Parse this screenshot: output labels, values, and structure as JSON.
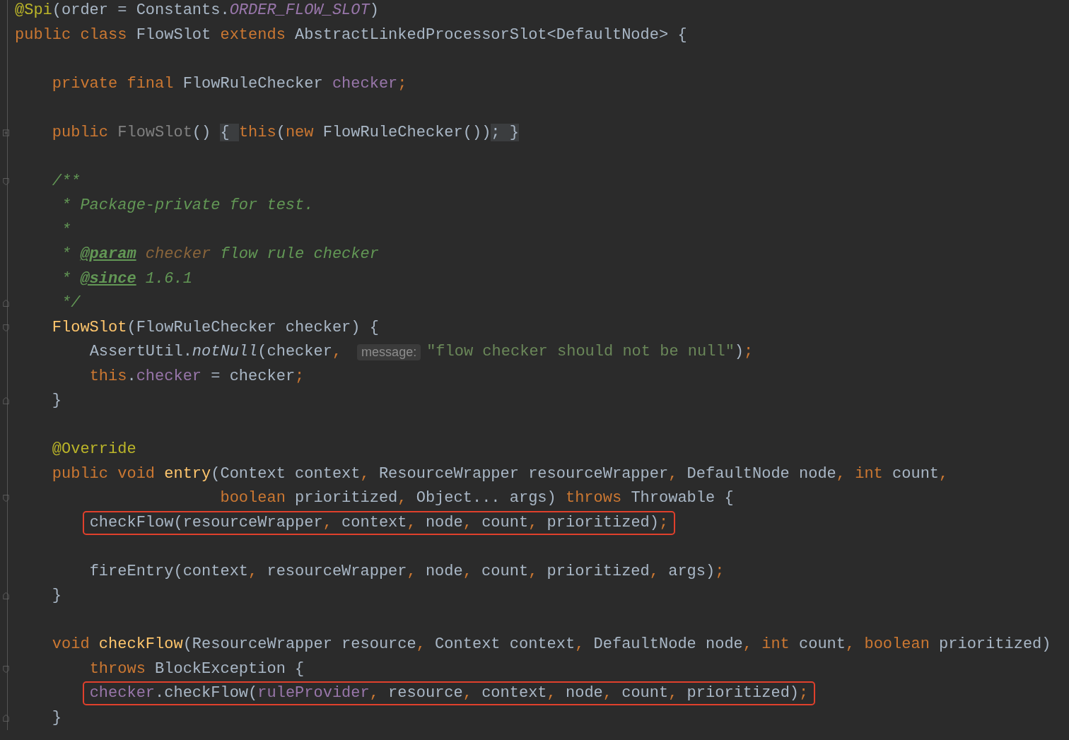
{
  "editor": {
    "lines": [
      {
        "kind": "code",
        "tokens": [
          {
            "kind": "ann",
            "text": "@Spi"
          },
          {
            "kind": "plain",
            "text": "(order = Constants."
          },
          {
            "kind": "const",
            "text": "ORDER_FLOW_SLOT"
          },
          {
            "kind": "plain",
            "text": ")"
          }
        ]
      },
      {
        "kind": "code",
        "tokens": [
          {
            "kind": "kw",
            "text": "public class "
          },
          {
            "kind": "plain",
            "text": "FlowSlot "
          },
          {
            "kind": "kw",
            "text": "extends "
          },
          {
            "kind": "plain",
            "text": "AbstractLinkedProcessorSlot<DefaultNode> {"
          }
        ]
      },
      {
        "kind": "blank"
      },
      {
        "kind": "code",
        "tokens": [
          {
            "kind": "kw",
            "text": "    private final "
          },
          {
            "kind": "plain",
            "text": "FlowRuleChecker "
          },
          {
            "kind": "field",
            "text": "checker"
          },
          {
            "kind": "kw",
            "text": ";"
          }
        ]
      },
      {
        "kind": "blank"
      },
      {
        "kind": "folded",
        "tokens": [
          {
            "kind": "kw",
            "text": "    public "
          },
          {
            "kind": "unused",
            "text": "FlowSlot"
          },
          {
            "kind": "plain",
            "text": "() "
          },
          {
            "kind": "folded",
            "text": "{ "
          },
          {
            "kind": "kw",
            "text": "this"
          },
          {
            "kind": "plain",
            "text": "("
          },
          {
            "kind": "kw",
            "text": "new "
          },
          {
            "kind": "plain",
            "text": "FlowRuleChecker())"
          },
          {
            "kind": "folded",
            "text": "; }"
          }
        ]
      },
      {
        "kind": "blank"
      },
      {
        "kind": "fold_start",
        "tokens": [
          {
            "kind": "doc",
            "text": "    /**"
          }
        ]
      },
      {
        "kind": "code",
        "tokens": [
          {
            "kind": "doc",
            "text": "     * Package-private for test."
          }
        ]
      },
      {
        "kind": "code",
        "tokens": [
          {
            "kind": "doc",
            "text": "     *"
          }
        ]
      },
      {
        "kind": "code",
        "tokens": [
          {
            "kind": "doc",
            "text": "     * "
          },
          {
            "kind": "doctag",
            "text": "@param"
          },
          {
            "kind": "docparam",
            "text": " checker"
          },
          {
            "kind": "doc",
            "text": " flow rule checker"
          }
        ]
      },
      {
        "kind": "code",
        "tokens": [
          {
            "kind": "doc",
            "text": "     * "
          },
          {
            "kind": "doctag",
            "text": "@since"
          },
          {
            "kind": "doc",
            "text": " 1.6.1"
          }
        ]
      },
      {
        "kind": "fold_end",
        "tokens": [
          {
            "kind": "doc",
            "text": "     */"
          }
        ]
      },
      {
        "kind": "fold_start",
        "tokens": [
          {
            "kind": "decl",
            "text": "    FlowSlot"
          },
          {
            "kind": "plain",
            "text": "(FlowRuleChecker checker) {"
          }
        ]
      },
      {
        "kind": "code",
        "tokens": [
          {
            "kind": "plain",
            "text": "        AssertUtil."
          },
          {
            "kind": "static",
            "text": "notNull"
          },
          {
            "kind": "plain",
            "text": "(checker"
          },
          {
            "kind": "kw",
            "text": ","
          },
          {
            "kind": "hint",
            "text": "message:"
          },
          {
            "kind": "string",
            "text": "\"flow checker should not be null\""
          },
          {
            "kind": "plain",
            "text": ")"
          },
          {
            "kind": "kw",
            "text": ";"
          }
        ]
      },
      {
        "kind": "code",
        "tokens": [
          {
            "kind": "kw",
            "text": "        this"
          },
          {
            "kind": "plain",
            "text": "."
          },
          {
            "kind": "field",
            "text": "checker"
          },
          {
            "kind": "plain",
            "text": " = checker"
          },
          {
            "kind": "kw",
            "text": ";"
          }
        ]
      },
      {
        "kind": "fold_end",
        "tokens": [
          {
            "kind": "plain",
            "text": "    }"
          }
        ]
      },
      {
        "kind": "blank"
      },
      {
        "kind": "code",
        "tokens": [
          {
            "kind": "ann",
            "text": "    @Override"
          }
        ]
      },
      {
        "kind": "code",
        "tokens": [
          {
            "kind": "kw",
            "text": "    public void "
          },
          {
            "kind": "decl",
            "text": "entry"
          },
          {
            "kind": "plain",
            "text": "(Context context"
          },
          {
            "kind": "kw",
            "text": ","
          },
          {
            "kind": "plain",
            "text": " ResourceWrapper resourceWrapper"
          },
          {
            "kind": "kw",
            "text": ","
          },
          {
            "kind": "plain",
            "text": " DefaultNode node"
          },
          {
            "kind": "kw",
            "text": ", int "
          },
          {
            "kind": "plain",
            "text": "count"
          },
          {
            "kind": "kw",
            "text": ","
          }
        ]
      },
      {
        "kind": "fold_start",
        "tokens": [
          {
            "kind": "kw",
            "text": "                      boolean "
          },
          {
            "kind": "plain",
            "text": "prioritized"
          },
          {
            "kind": "kw",
            "text": ","
          },
          {
            "kind": "plain",
            "text": " Object... args) "
          },
          {
            "kind": "kw",
            "text": "throws "
          },
          {
            "kind": "plain",
            "text": "Throwable {"
          }
        ]
      },
      {
        "kind": "code",
        "highlighted": true,
        "tokens": [
          {
            "kind": "plain",
            "text": "        checkFlow(resourceWrapper"
          },
          {
            "kind": "kw",
            "text": ","
          },
          {
            "kind": "plain",
            "text": " context"
          },
          {
            "kind": "kw",
            "text": ","
          },
          {
            "kind": "plain",
            "text": " node"
          },
          {
            "kind": "kw",
            "text": ","
          },
          {
            "kind": "plain",
            "text": " count"
          },
          {
            "kind": "kw",
            "text": ","
          },
          {
            "kind": "plain",
            "text": " prioritized)"
          },
          {
            "kind": "kw",
            "text": ";"
          }
        ]
      },
      {
        "kind": "blank"
      },
      {
        "kind": "code",
        "tokens": [
          {
            "kind": "plain",
            "text": "        fireEntry(context"
          },
          {
            "kind": "kw",
            "text": ","
          },
          {
            "kind": "plain",
            "text": " resourceWrapper"
          },
          {
            "kind": "kw",
            "text": ","
          },
          {
            "kind": "plain",
            "text": " node"
          },
          {
            "kind": "kw",
            "text": ","
          },
          {
            "kind": "plain",
            "text": " count"
          },
          {
            "kind": "kw",
            "text": ","
          },
          {
            "kind": "plain",
            "text": " prioritized"
          },
          {
            "kind": "kw",
            "text": ","
          },
          {
            "kind": "plain",
            "text": " args)"
          },
          {
            "kind": "kw",
            "text": ";"
          }
        ]
      },
      {
        "kind": "fold_end",
        "tokens": [
          {
            "kind": "plain",
            "text": "    }"
          }
        ]
      },
      {
        "kind": "blank"
      },
      {
        "kind": "code",
        "tokens": [
          {
            "kind": "kw",
            "text": "    void "
          },
          {
            "kind": "decl",
            "text": "checkFlow"
          },
          {
            "kind": "plain",
            "text": "(ResourceWrapper resource"
          },
          {
            "kind": "kw",
            "text": ","
          },
          {
            "kind": "plain",
            "text": " Context context"
          },
          {
            "kind": "kw",
            "text": ","
          },
          {
            "kind": "plain",
            "text": " DefaultNode node"
          },
          {
            "kind": "kw",
            "text": ", int "
          },
          {
            "kind": "plain",
            "text": "count"
          },
          {
            "kind": "kw",
            "text": ", boolean "
          },
          {
            "kind": "plain",
            "text": "prioritized)"
          }
        ]
      },
      {
        "kind": "fold_start",
        "tokens": [
          {
            "kind": "kw",
            "text": "        throws "
          },
          {
            "kind": "plain",
            "text": "BlockException {"
          }
        ]
      },
      {
        "kind": "code",
        "highlighted": true,
        "tokens": [
          {
            "kind": "field",
            "text": "        checker"
          },
          {
            "kind": "plain",
            "text": ".checkFlow("
          },
          {
            "kind": "field",
            "text": "ruleProvider"
          },
          {
            "kind": "kw",
            "text": ","
          },
          {
            "kind": "plain",
            "text": " resource"
          },
          {
            "kind": "kw",
            "text": ","
          },
          {
            "kind": "plain",
            "text": " context"
          },
          {
            "kind": "kw",
            "text": ","
          },
          {
            "kind": "plain",
            "text": " node"
          },
          {
            "kind": "kw",
            "text": ","
          },
          {
            "kind": "plain",
            "text": " count"
          },
          {
            "kind": "kw",
            "text": ","
          },
          {
            "kind": "plain",
            "text": " prioritized)"
          },
          {
            "kind": "kw",
            "text": ";"
          }
        ]
      },
      {
        "kind": "fold_end",
        "tokens": [
          {
            "kind": "plain",
            "text": "    }"
          }
        ]
      }
    ]
  }
}
